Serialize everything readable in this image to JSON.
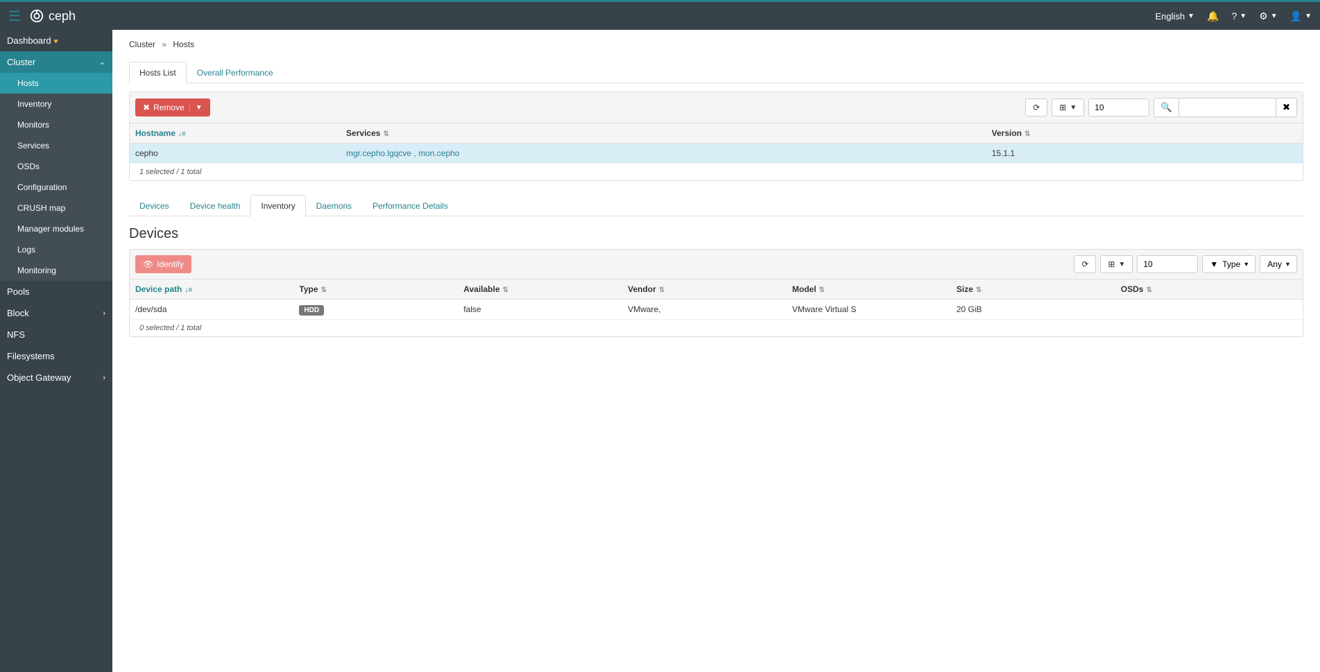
{
  "navbar": {
    "brand": "ceph",
    "language": "English"
  },
  "sidebar": {
    "dashboard": "Dashboard",
    "cluster": "Cluster",
    "cluster_items": [
      "Hosts",
      "Inventory",
      "Monitors",
      "Services",
      "OSDs",
      "Configuration",
      "CRUSH map",
      "Manager modules",
      "Logs",
      "Monitoring"
    ],
    "pools": "Pools",
    "block": "Block",
    "nfs": "NFS",
    "filesystems": "Filesystems",
    "object_gateway": "Object Gateway"
  },
  "breadcrumb": {
    "cluster": "Cluster",
    "hosts": "Hosts"
  },
  "main_tabs": {
    "hosts_list": "Hosts List",
    "overall_perf": "Overall Performance"
  },
  "hosts_toolbar": {
    "remove": "Remove",
    "page_size": "10"
  },
  "hosts_table": {
    "headers": {
      "hostname": "Hostname",
      "services": "Services",
      "version": "Version"
    },
    "rows": [
      {
        "hostname": "cepho",
        "services": "mgr.cepho.lgqcve , mon.cepho",
        "version": "15.1.1"
      }
    ],
    "footer": "1 selected / 1 total"
  },
  "detail_tabs": {
    "devices": "Devices",
    "device_health": "Device health",
    "inventory": "Inventory",
    "daemons": "Daemons",
    "perf_details": "Performance Details"
  },
  "devices_section": {
    "title": "Devices",
    "identify": "Identify",
    "page_size": "10",
    "filter_type": "Type",
    "filter_any": "Any"
  },
  "devices_table": {
    "headers": {
      "device_path": "Device path",
      "type": "Type",
      "available": "Available",
      "vendor": "Vendor",
      "model": "Model",
      "size": "Size",
      "osds": "OSDs"
    },
    "rows": [
      {
        "device_path": "/dev/sda",
        "type": "HDD",
        "available": "false",
        "vendor": "VMware,",
        "model": "VMware Virtual S",
        "size": "20 GiB",
        "osds": ""
      }
    ],
    "footer": "0 selected / 1 total"
  }
}
